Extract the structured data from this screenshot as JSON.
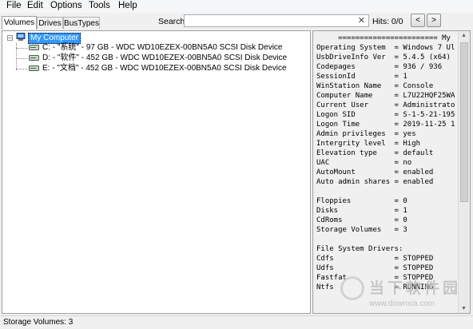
{
  "menu": [
    "File",
    "Edit",
    "Options",
    "Tools",
    "Help"
  ],
  "tabs": [
    "Volumes",
    "Drives",
    "BusTypes"
  ],
  "search": {
    "label": "Search:",
    "value": "",
    "clear": "✕"
  },
  "hits": {
    "label": "Hits:",
    "count": "0/0"
  },
  "nav": {
    "prev": "<",
    "next": ">"
  },
  "tree": {
    "root": "My Computer",
    "items": [
      "C: - \"系统\" - 97 GB - WDC WD10EZEX-00BN5A0 SCSI Disk Device",
      "D: - \"软件\" - 452 GB - WDC WD10EZEX-00BN5A0 SCSI Disk Device",
      "E: - \"文档\" - 452 GB - WDC WD10EZEX-00BN5A0 SCSI Disk Device"
    ]
  },
  "info": [
    "     ======================= My",
    "Operating System  = Windows 7 Ul",
    "UsbDriveInfo Ver  = 5.4.5 (x64)",
    "Codepages         = 936 / 936",
    "SessionId         = 1",
    "WinStation Name   = Console",
    "Computer Name     = L7U22HQF25WA",
    "Current User      = Administrato",
    "Logon SID         = S-1-5-21-195",
    "Logon Time        = 2019-11-25 1",
    "Admin privileges  = yes",
    "Intergrity level  = High",
    "Elevation type    = default",
    "UAC               = no",
    "AutoMount         = enabled",
    "Auto admin shares = enabled",
    "",
    "Floppies          = 0",
    "Disks             = 1",
    "CdRoms            = 0",
    "Storage Volumes   = 3",
    "",
    "File System Drivers:",
    "Cdfs              = STOPPED",
    "Udfs              = STOPPED",
    "Fastfat           = STOPPED",
    "Ntfs              = RUNNING"
  ],
  "status": "Storage Volumes: 3",
  "watermark": {
    "brand": "当下软件园",
    "url": "www.downxia.com"
  },
  "colors": {
    "selection": "#3399ff",
    "background": "#f0f0f0"
  }
}
